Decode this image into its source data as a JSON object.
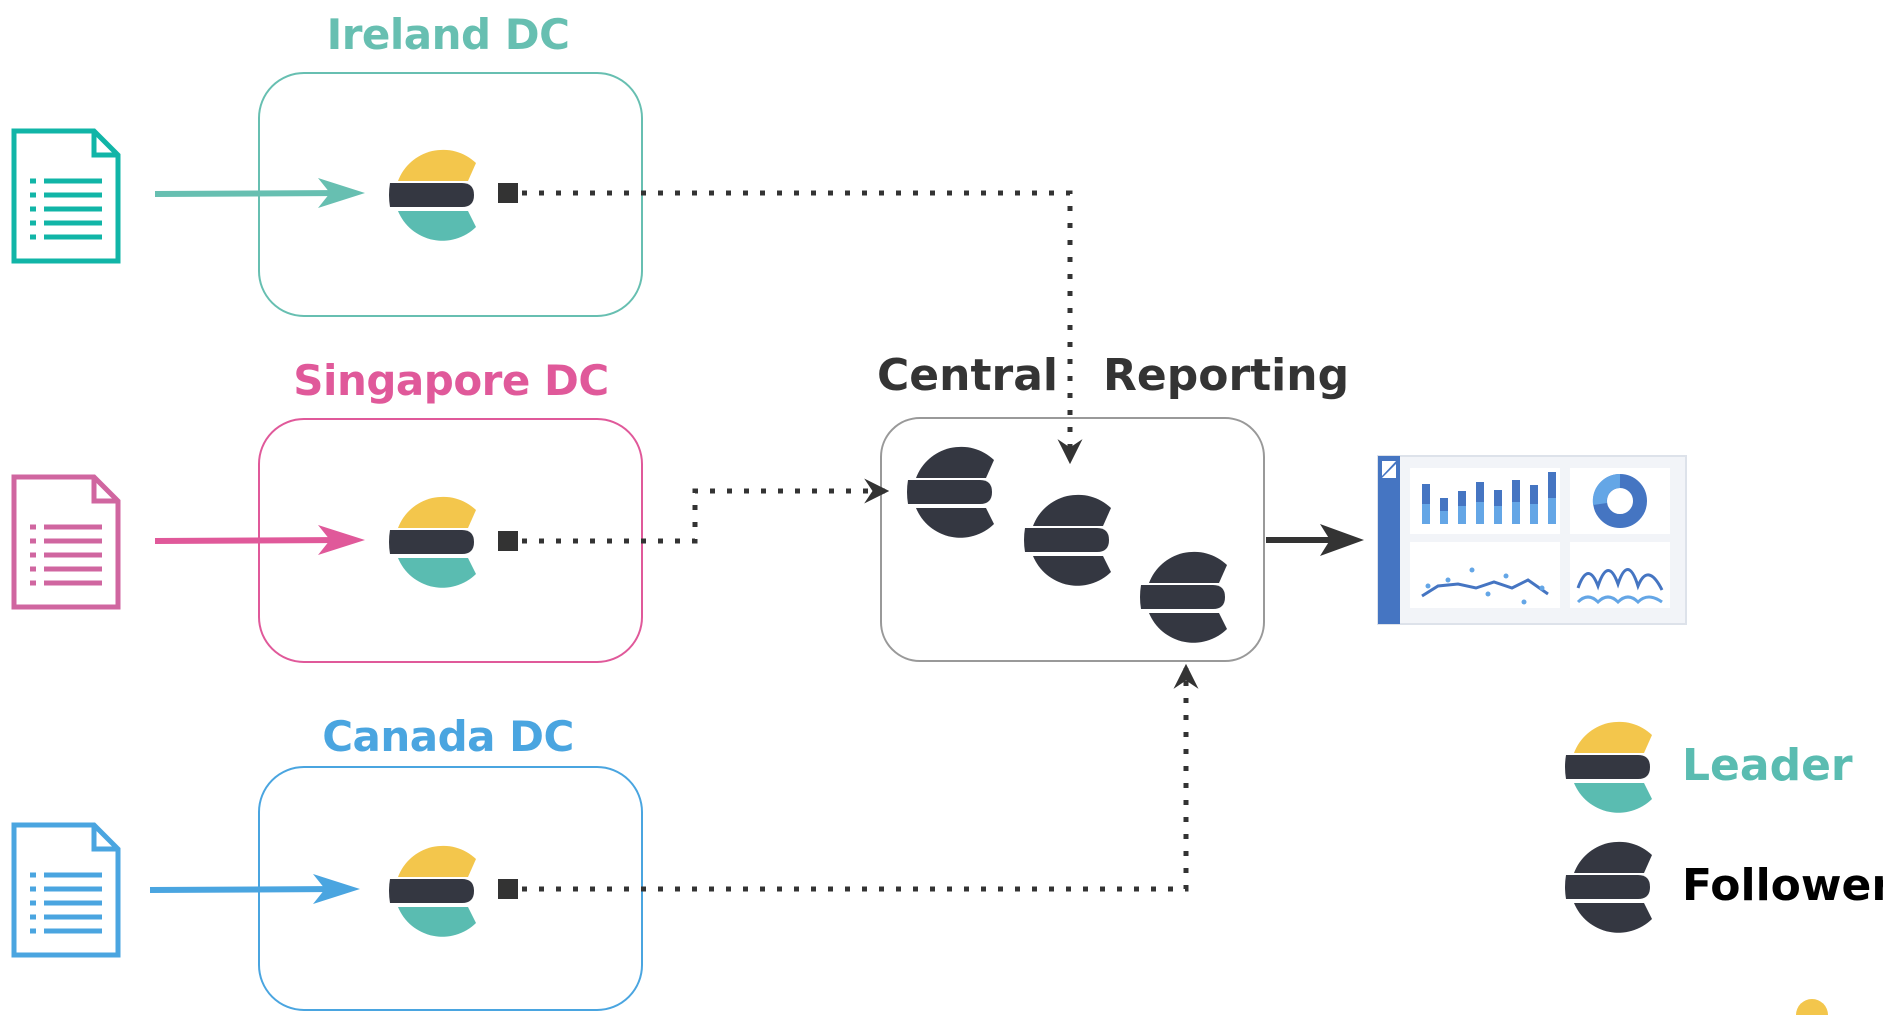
{
  "colors": {
    "ireland": "#67bfb1",
    "singapore": "#e0599a",
    "canada": "#4aa5e0",
    "dark": "#343741",
    "connector": "#333333",
    "central_border": "#999999",
    "leader_top": "#f3c64c",
    "leader_bottom": "#5abcb1",
    "kibana_sidebar": "#4575c2",
    "kibana_light": "#64a6e6",
    "kibana_panel_bg": "#f2f4f8"
  },
  "datacenters": [
    {
      "id": "ireland",
      "title": "Ireland DC"
    },
    {
      "id": "singapore",
      "title": "Singapore DC"
    },
    {
      "id": "canada",
      "title": "Canada DC"
    }
  ],
  "central": {
    "left_label": "Central",
    "right_label": "Reporting"
  },
  "legend": {
    "items": [
      {
        "label": "Leader",
        "role": "leader"
      },
      {
        "label": "Follower",
        "role": "follower"
      }
    ]
  },
  "icons": {
    "document": "document-icon",
    "leader": "elasticsearch-leader-icon",
    "follower": "elasticsearch-follower-icon",
    "kibana": "kibana-dashboard-icon"
  }
}
